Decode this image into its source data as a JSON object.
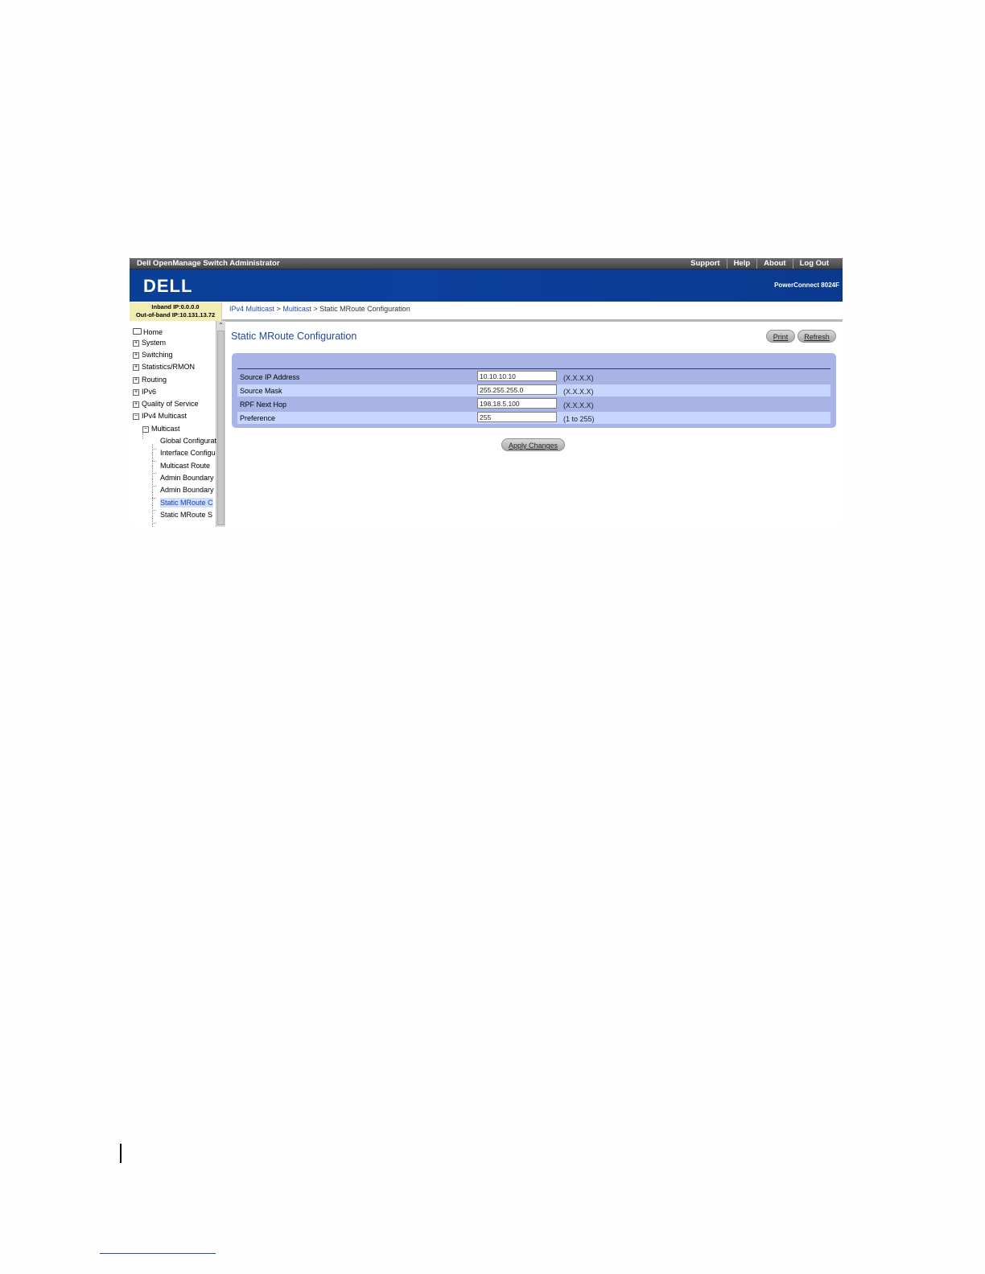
{
  "window": {
    "app_title": "Dell OpenManage Switch Administrator",
    "links": [
      "Support",
      "Help",
      "About",
      "Log Out"
    ]
  },
  "brand": {
    "logo": "DELL",
    "model": "PowerConnect 8024F"
  },
  "ip_info": {
    "inband": "Inband IP:0.0.0.0",
    "out_of_band": "Out-of-band IP:10.131.13.72"
  },
  "breadcrumb": {
    "items": [
      "IPv4 Multicast",
      "Multicast",
      "Static MRoute Configuration"
    ],
    "separator": ">"
  },
  "sidebar": {
    "items": [
      {
        "label": "Home",
        "icon": "home-icon"
      },
      {
        "label": "System",
        "icon": "expand-icon"
      },
      {
        "label": "Switching",
        "icon": "expand-icon"
      },
      {
        "label": "Statistics/RMON",
        "icon": "expand-icon"
      },
      {
        "label": "Routing",
        "icon": "expand-icon"
      },
      {
        "label": "IPv6",
        "icon": "expand-icon"
      },
      {
        "label": "Quality of Service",
        "icon": "expand-icon"
      },
      {
        "label": "IPv4 Multicast",
        "icon": "collapse-icon"
      },
      {
        "label": "Multicast",
        "icon": "collapse-icon"
      },
      {
        "label": "Global Configurat"
      },
      {
        "label": "Interface Configu"
      },
      {
        "label": "Multicast Route "
      },
      {
        "label": "Admin Boundary"
      },
      {
        "label": "Admin Boundary"
      },
      {
        "label": "Static MRoute C",
        "selected": true
      },
      {
        "label": "Static MRoute S"
      }
    ]
  },
  "main": {
    "title": "Static MRoute Configuration",
    "print_label": "Print",
    "refresh_label": "Refresh",
    "fields": [
      {
        "label": "Source IP Address",
        "value": "10.10.10.10",
        "hint": "(X.X.X.X)"
      },
      {
        "label": "Source Mask",
        "value": "255.255.255.0",
        "hint": "(X.X.X.X)"
      },
      {
        "label": "RPF Next Hop",
        "value": "198.18.5.100",
        "hint": "(X.X.X.X)"
      },
      {
        "label": "Preference",
        "value": "255",
        "hint": "(1 to 255)"
      }
    ],
    "apply_label": "Apply Changes"
  },
  "colors": {
    "brand_blue": "#0d3f9e",
    "panel": "#a8b4e6",
    "row_highlight": "#c6d6ff",
    "title_blue": "#21479e"
  }
}
